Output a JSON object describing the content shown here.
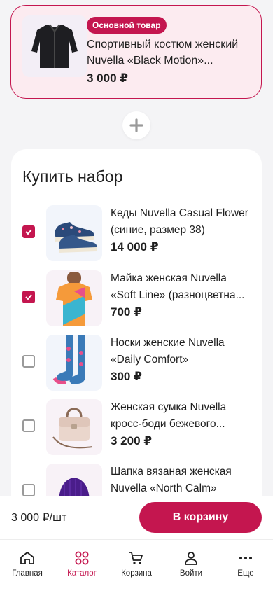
{
  "main_product": {
    "badge": "Основной товар",
    "title": "Спортивный костюм женский Nuvella «Black Motion»...",
    "price": "3 000 ₽"
  },
  "set": {
    "title": "Купить набор",
    "items": [
      {
        "name": "Кеды Nuvella Casual Flower (синие, размер 38)",
        "price": "14 000 ₽",
        "checked": true,
        "icon": "sneakers-image"
      },
      {
        "name": "Майка женская Nuvella «Soft Line» (разноцветна...",
        "price": "700 ₽",
        "checked": true,
        "icon": "tshirt-image"
      },
      {
        "name": "Носки женские Nuvella «Daily Comfort»",
        "price": "300 ₽",
        "checked": false,
        "icon": "socks-image"
      },
      {
        "name": "Женская сумка Nuvella кросс-боди бежевого...",
        "price": "3 200 ₽",
        "checked": false,
        "icon": "handbag-image"
      },
      {
        "name": "Шапка вязаная женская Nuvella «North Calm»",
        "price": "",
        "checked": false,
        "icon": "beanie-image"
      }
    ]
  },
  "bottom": {
    "unit_price": "3 000 ₽/шт",
    "cart_button": "В корзину"
  },
  "tabs": [
    {
      "label": "Главная",
      "icon": "home-icon",
      "active": false
    },
    {
      "label": "Каталог",
      "icon": "catalog-icon",
      "active": true
    },
    {
      "label": "Корзина",
      "icon": "cart-icon",
      "active": false
    },
    {
      "label": "Войти",
      "icon": "user-icon",
      "active": false
    },
    {
      "label": "Еще",
      "icon": "more-icon",
      "active": false
    }
  ],
  "colors": {
    "accent": "#c4164f",
    "main_card_bg": "#fcebf0",
    "page_bg": "#f4f4f6"
  }
}
